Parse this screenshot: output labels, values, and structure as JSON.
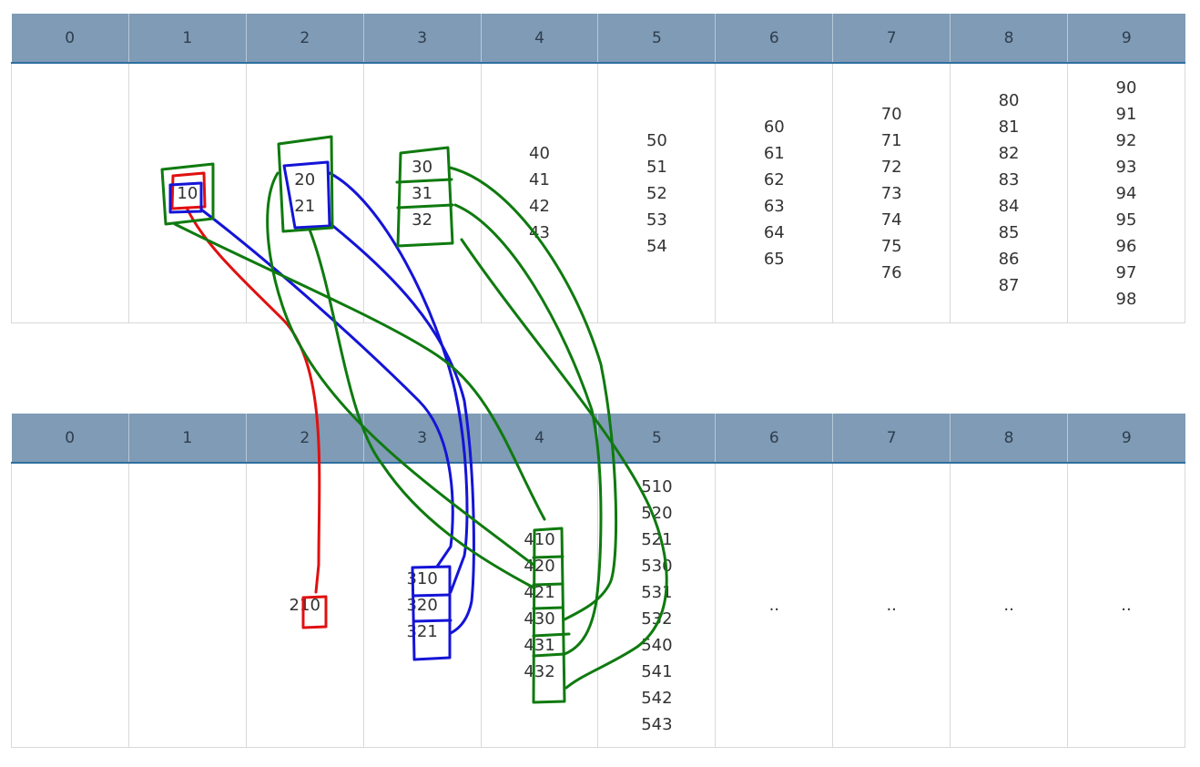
{
  "top_table": {
    "headers": [
      "0",
      "1",
      "2",
      "3",
      "4",
      "5",
      "6",
      "7",
      "8",
      "9"
    ],
    "cells": [
      [],
      [
        "10"
      ],
      [
        "20",
        "21"
      ],
      [
        "30",
        "31",
        "32"
      ],
      [
        "40",
        "41",
        "42",
        "43"
      ],
      [
        "50",
        "51",
        "52",
        "53",
        "54"
      ],
      [
        "60",
        "61",
        "62",
        "63",
        "64",
        "65"
      ],
      [
        "70",
        "71",
        "72",
        "73",
        "74",
        "75",
        "76"
      ],
      [
        "80",
        "81",
        "82",
        "83",
        "84",
        "85",
        "86",
        "87"
      ],
      [
        "90",
        "91",
        "92",
        "93",
        "94",
        "95",
        "96",
        "97",
        "98"
      ]
    ]
  },
  "bottom_table": {
    "headers": [
      "0",
      "1",
      "2",
      "3",
      "4",
      "5",
      "6",
      "7",
      "8",
      "9"
    ],
    "cells": [
      [],
      [],
      [
        "210"
      ],
      [
        "310",
        "320",
        "321"
      ],
      [
        "410",
        "420",
        "421",
        "430",
        "431",
        "432"
      ],
      [
        "510",
        "520",
        "521",
        "530",
        "531",
        "532",
        "540",
        "541",
        "542",
        "543"
      ],
      [
        ".."
      ],
      [
        ".."
      ],
      [
        ".."
      ],
      [
        ".."
      ]
    ]
  },
  "annotation_colors": {
    "red": "#e01010",
    "blue": "#1414d8",
    "green": "#0f7a0f"
  }
}
